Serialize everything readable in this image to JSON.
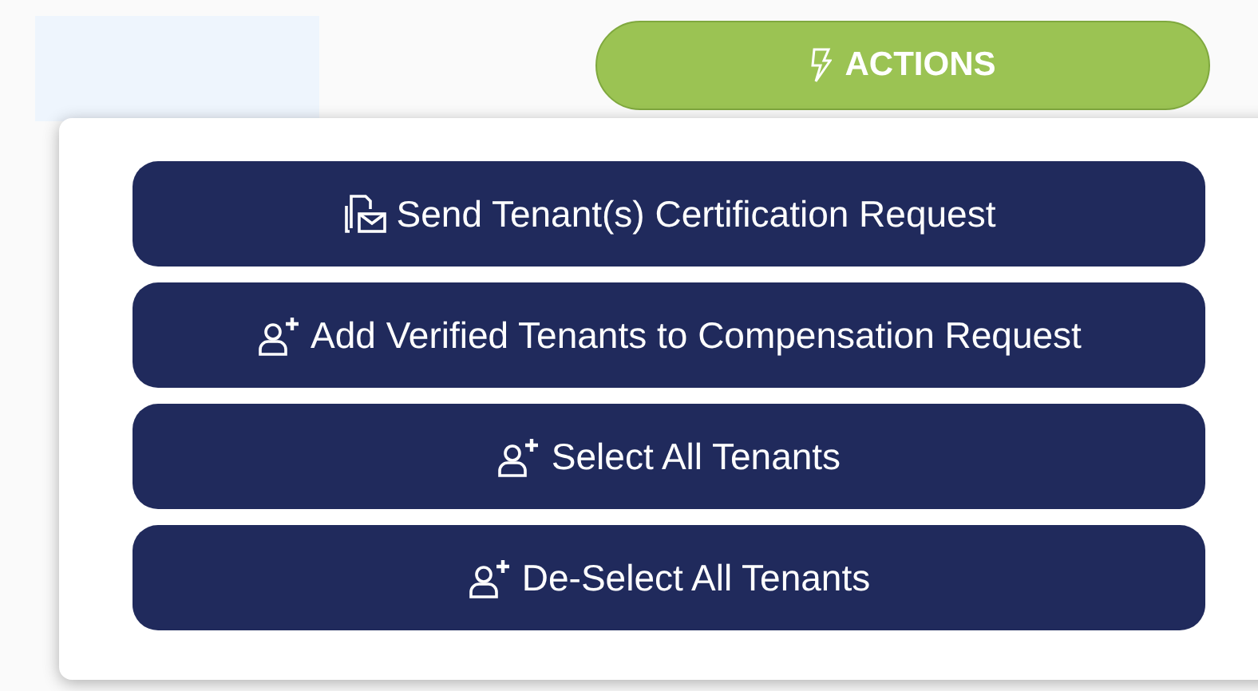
{
  "actions_button": {
    "label": "ACTIONS"
  },
  "menu": {
    "items": [
      {
        "kind": "mail",
        "label": "Send Tenant(s) Certification Request"
      },
      {
        "kind": "user-plus",
        "label": "Add Verified Tenants to Compensation Request"
      },
      {
        "kind": "user-plus",
        "label": "Select All Tenants"
      },
      {
        "kind": "user-plus",
        "label": "De-Select All Tenants"
      }
    ]
  }
}
